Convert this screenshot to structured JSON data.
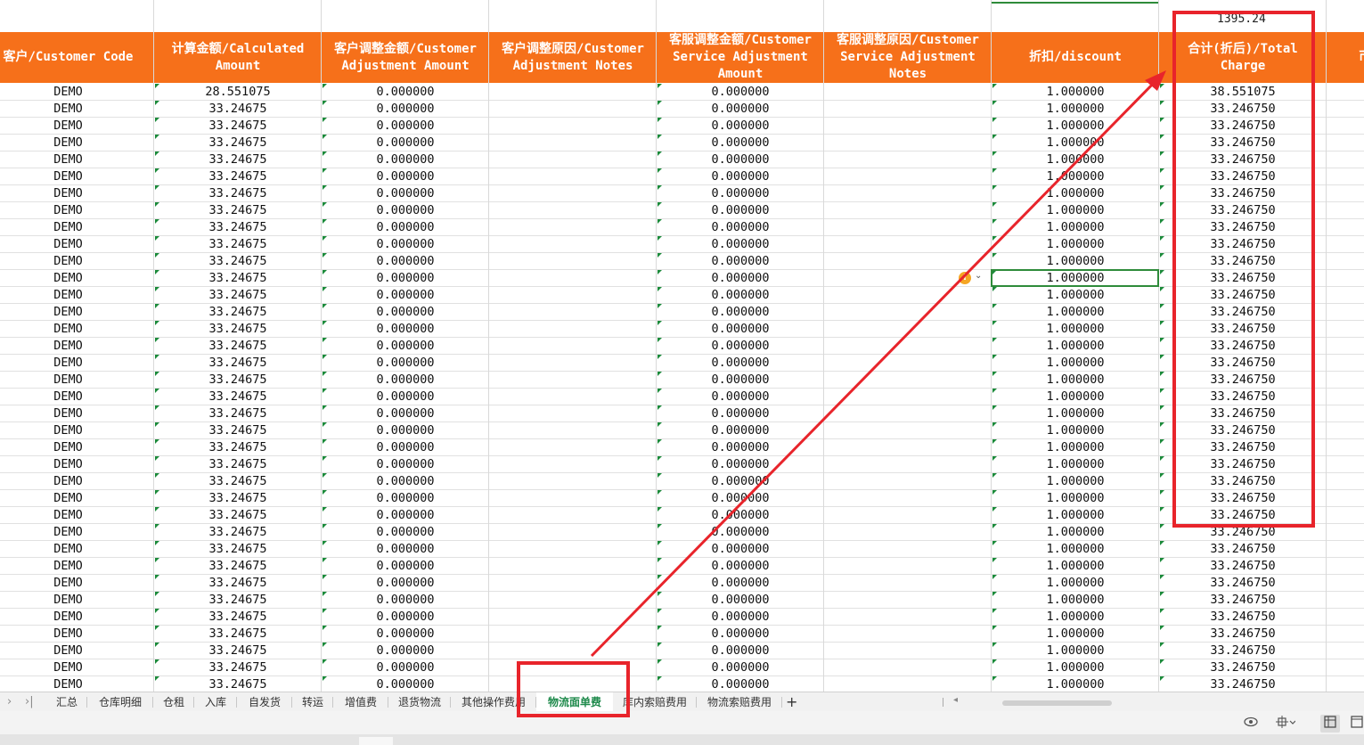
{
  "top_row": {
    "total_value": "1395.24"
  },
  "headers": [
    "客户/Customer Code",
    "计算金额/Calculated\nAmount",
    "客户调整金额/Customer\nAdjustment Amount",
    "客户调整原因/Customer\nAdjustment Notes",
    "客服调整金额/Customer\nService Adjustment\nAmount",
    "客服调整原因/Customer\nService Adjustment\nNotes",
    "折扣/discount",
    "合计(折后)/Total\nCharge",
    "币"
  ],
  "rows": [
    [
      "DEMO",
      "28.551075",
      "0.000000",
      "",
      "0.000000",
      "",
      "1.000000",
      "38.551075"
    ],
    [
      "DEMO",
      "33.24675",
      "0.000000",
      "",
      "0.000000",
      "",
      "1.000000",
      "33.246750"
    ],
    [
      "DEMO",
      "33.24675",
      "0.000000",
      "",
      "0.000000",
      "",
      "1.000000",
      "33.246750"
    ],
    [
      "DEMO",
      "33.24675",
      "0.000000",
      "",
      "0.000000",
      "",
      "1.000000",
      "33.246750"
    ],
    [
      "DEMO",
      "33.24675",
      "0.000000",
      "",
      "0.000000",
      "",
      "1.000000",
      "33.246750"
    ],
    [
      "DEMO",
      "33.24675",
      "0.000000",
      "",
      "0.000000",
      "",
      "1.000000",
      "33.246750"
    ],
    [
      "DEMO",
      "33.24675",
      "0.000000",
      "",
      "0.000000",
      "",
      "1.000000",
      "33.246750"
    ],
    [
      "DEMO",
      "33.24675",
      "0.000000",
      "",
      "0.000000",
      "",
      "1.000000",
      "33.246750"
    ],
    [
      "DEMO",
      "33.24675",
      "0.000000",
      "",
      "0.000000",
      "",
      "1.000000",
      "33.246750"
    ],
    [
      "DEMO",
      "33.24675",
      "0.000000",
      "",
      "0.000000",
      "",
      "1.000000",
      "33.246750"
    ],
    [
      "DEMO",
      "33.24675",
      "0.000000",
      "",
      "0.000000",
      "",
      "1.000000",
      "33.246750"
    ],
    [
      "DEMO",
      "33.24675",
      "0.000000",
      "",
      "0.000000",
      "",
      "1.000000",
      "33.246750"
    ],
    [
      "DEMO",
      "33.24675",
      "0.000000",
      "",
      "0.000000",
      "",
      "1.000000",
      "33.246750"
    ],
    [
      "DEMO",
      "33.24675",
      "0.000000",
      "",
      "0.000000",
      "",
      "1.000000",
      "33.246750"
    ],
    [
      "DEMO",
      "33.24675",
      "0.000000",
      "",
      "0.000000",
      "",
      "1.000000",
      "33.246750"
    ],
    [
      "DEMO",
      "33.24675",
      "0.000000",
      "",
      "0.000000",
      "",
      "1.000000",
      "33.246750"
    ],
    [
      "DEMO",
      "33.24675",
      "0.000000",
      "",
      "0.000000",
      "",
      "1.000000",
      "33.246750"
    ],
    [
      "DEMO",
      "33.24675",
      "0.000000",
      "",
      "0.000000",
      "",
      "1.000000",
      "33.246750"
    ],
    [
      "DEMO",
      "33.24675",
      "0.000000",
      "",
      "0.000000",
      "",
      "1.000000",
      "33.246750"
    ],
    [
      "DEMO",
      "33.24675",
      "0.000000",
      "",
      "0.000000",
      "",
      "1.000000",
      "33.246750"
    ],
    [
      "DEMO",
      "33.24675",
      "0.000000",
      "",
      "0.000000",
      "",
      "1.000000",
      "33.246750"
    ],
    [
      "DEMO",
      "33.24675",
      "0.000000",
      "",
      "0.000000",
      "",
      "1.000000",
      "33.246750"
    ],
    [
      "DEMO",
      "33.24675",
      "0.000000",
      "",
      "0.000000",
      "",
      "1.000000",
      "33.246750"
    ],
    [
      "DEMO",
      "33.24675",
      "0.000000",
      "",
      "0.000000",
      "",
      "1.000000",
      "33.246750"
    ],
    [
      "DEMO",
      "33.24675",
      "0.000000",
      "",
      "0.000000",
      "",
      "1.000000",
      "33.246750"
    ],
    [
      "DEMO",
      "33.24675",
      "0.000000",
      "",
      "0.000000",
      "",
      "1.000000",
      "33.246750"
    ],
    [
      "DEMO",
      "33.24675",
      "0.000000",
      "",
      "0.000000",
      "",
      "1.000000",
      "33.246750"
    ],
    [
      "DEMO",
      "33.24675",
      "0.000000",
      "",
      "0.000000",
      "",
      "1.000000",
      "33.246750"
    ],
    [
      "DEMO",
      "33.24675",
      "0.000000",
      "",
      "0.000000",
      "",
      "1.000000",
      "33.246750"
    ],
    [
      "DEMO",
      "33.24675",
      "0.000000",
      "",
      "0.000000",
      "",
      "1.000000",
      "33.246750"
    ],
    [
      "DEMO",
      "33.24675",
      "0.000000",
      "",
      "0.000000",
      "",
      "1.000000",
      "33.246750"
    ],
    [
      "DEMO",
      "33.24675",
      "0.000000",
      "",
      "0.000000",
      "",
      "1.000000",
      "33.246750"
    ],
    [
      "DEMO",
      "33.24675",
      "0.000000",
      "",
      "0.000000",
      "",
      "1.000000",
      "33.246750"
    ],
    [
      "DEMO",
      "33.24675",
      "0.000000",
      "",
      "0.000000",
      "",
      "1.000000",
      "33.246750"
    ],
    [
      "DEMO",
      "33.24675",
      "0.000000",
      "",
      "0.000000",
      "",
      "1.000000",
      "33.246750"
    ],
    [
      "DEMO",
      "33.24675",
      "0.000000",
      "",
      "0.000000",
      "",
      "1.000000",
      "33.246750"
    ]
  ],
  "sheet_tabs": [
    {
      "label": "汇总"
    },
    {
      "label": "仓库明细"
    },
    {
      "label": "仓租"
    },
    {
      "label": "入库"
    },
    {
      "label": "自发货"
    },
    {
      "label": "转运"
    },
    {
      "label": "增值费"
    },
    {
      "label": "退货物流"
    },
    {
      "label": "其他操作费用"
    },
    {
      "label": "物流面单费",
      "active": true
    },
    {
      "label": "库内索赔费用"
    },
    {
      "label": "物流索赔费用"
    }
  ],
  "tab_nav": {
    "prev": "›",
    "last": "›|",
    "add": "+"
  },
  "status_icons": [
    "eye-icon",
    "crosshair-icon",
    "normal-view-icon",
    "page-layout-icon"
  ],
  "annotation_color": "#e8242b",
  "header_color": "#f6701a",
  "active_tab_color": "#1f8a4c"
}
